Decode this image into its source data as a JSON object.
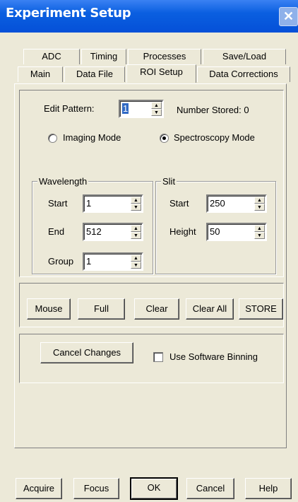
{
  "window": {
    "title": "Experiment Setup",
    "close_glyph": "✕"
  },
  "tabs_row1": [
    "ADC",
    "Timing",
    "Processes",
    "Save/Load"
  ],
  "tabs_row2": [
    "Main",
    "Data File",
    "ROI Setup",
    "Data Corrections"
  ],
  "active_tab": "ROI Setup",
  "edit_pattern": {
    "label": "Edit Pattern:",
    "value": "1",
    "number_stored_label": "Number Stored: 0"
  },
  "modes": {
    "imaging": "Imaging Mode",
    "spectroscopy": "Spectroscopy Mode",
    "selected": "spectroscopy"
  },
  "wavelength": {
    "title": "Wavelength",
    "start_label": "Start",
    "start_value": "1",
    "end_label": "End",
    "end_value": "512",
    "group_label": "Group",
    "group_value": "1"
  },
  "slit": {
    "title": "Slit",
    "start_label": "Start",
    "start_value": "250",
    "height_label": "Height",
    "height_value": "50"
  },
  "roi_buttons": {
    "mouse": "Mouse",
    "full": "Full",
    "clear": "Clear",
    "clear_all": "Clear All",
    "store": "STORE"
  },
  "cancel_changes": "Cancel Changes",
  "software_binning": {
    "label": "Use Software Binning",
    "checked": false
  },
  "bottom_buttons": {
    "acquire": "Acquire",
    "focus": "Focus",
    "ok": "OK",
    "cancel": "Cancel",
    "help": "Help"
  },
  "colors": {
    "titlebar": "#0a5fe0",
    "face": "#ece9d8",
    "selection": "#316ac5"
  }
}
